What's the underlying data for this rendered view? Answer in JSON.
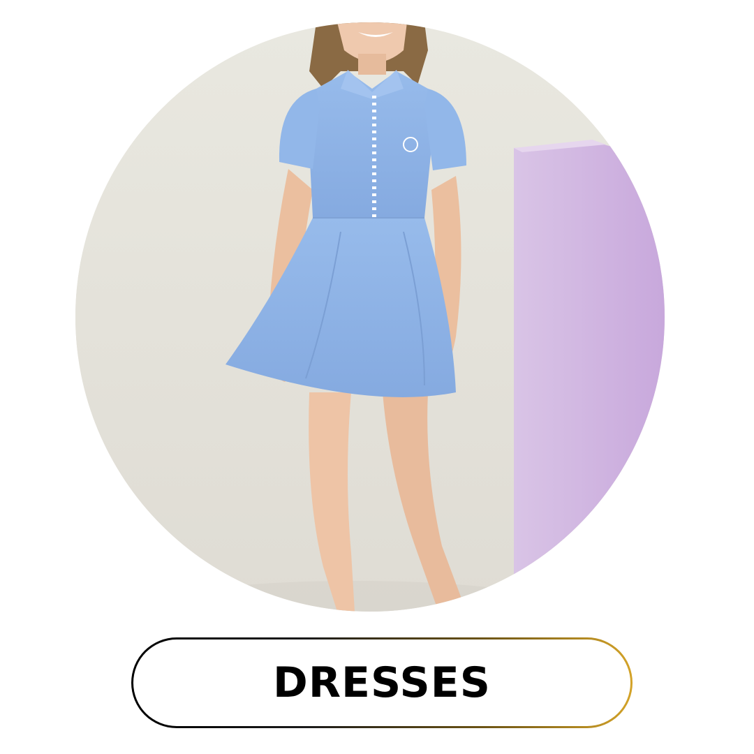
{
  "category": {
    "label": "DRESSES"
  },
  "image": {
    "subject": "girl-in-blue-dress",
    "colors": {
      "background": "#e6e4dc",
      "dress": "#8fb4e6",
      "pedestal": "#d6bde4"
    }
  },
  "border_gradient": [
    "#000000",
    "#d4a328"
  ]
}
